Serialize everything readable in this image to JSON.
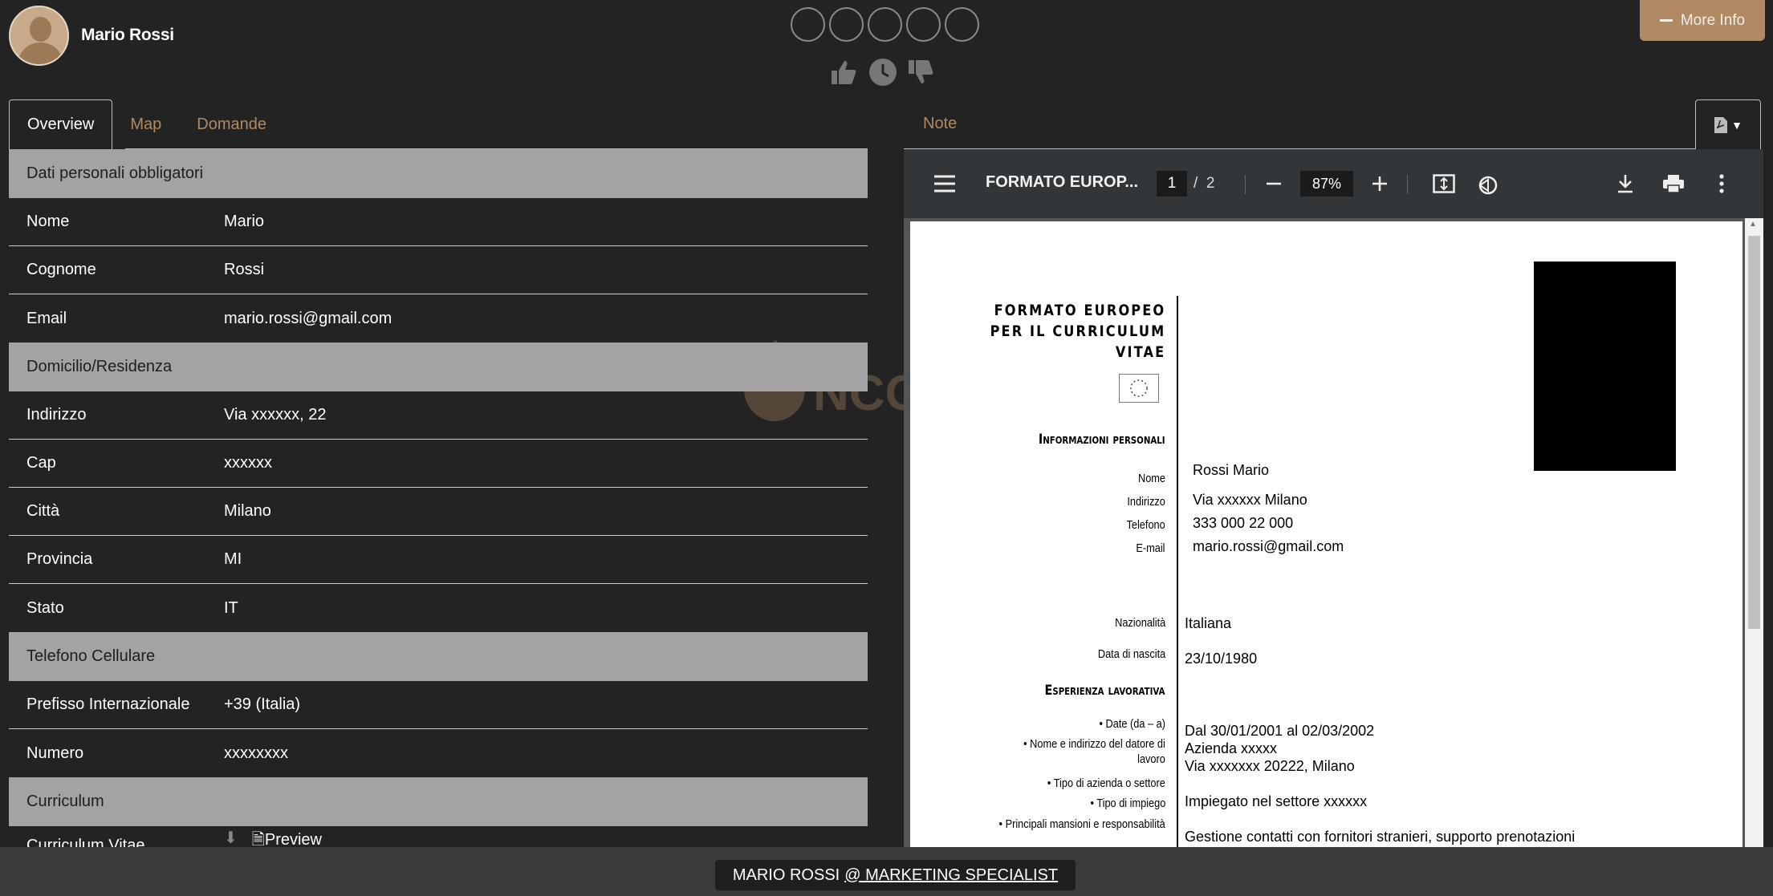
{
  "user": {
    "name": "Mario Rossi"
  },
  "header": {
    "more_info": "More Info",
    "rating_circles": 5
  },
  "tabs": [
    "Overview",
    "Map",
    "Domande"
  ],
  "right_tab": "Note",
  "sections": [
    {
      "title": "Dati personali obbligatori",
      "rows": [
        {
          "label": "Nome",
          "value": "Mario"
        },
        {
          "label": "Cognome",
          "value": "Rossi"
        },
        {
          "label": "Email",
          "value": "mario.rossi@gmail.com"
        }
      ]
    },
    {
      "title": "Domicilio/Residenza",
      "rows": [
        {
          "label": "Indirizzo",
          "value": "Via xxxxxx, 22"
        },
        {
          "label": "Cap",
          "value": "xxxxxx"
        },
        {
          "label": "Città",
          "value": "Milano"
        },
        {
          "label": "Provincia",
          "value": "MI"
        },
        {
          "label": "Stato",
          "value": "IT"
        }
      ]
    },
    {
      "title": "Telefono Cellulare",
      "rows": [
        {
          "label": "Prefisso Internazionale",
          "value": "+39 (Italia)"
        },
        {
          "label": "Numero",
          "value": "xxxxxxxx"
        }
      ]
    },
    {
      "title": "Curriculum",
      "rows": [
        {
          "label": "Curriculum Vitae",
          "value": "Preview"
        }
      ]
    }
  ],
  "viewer": {
    "title": "FORMATO EUROP...",
    "page": "1",
    "pages": "2",
    "zoom": "87%"
  },
  "cv": {
    "title": "FORMATO EUROPEO PER IL CURRICULUM VITAE",
    "title_lines": [
      "FORMATO EUROPEO",
      "PER IL CURRICULUM",
      "VITAE"
    ],
    "info_head": "Informazioni personali",
    "info": [
      {
        "label": "Nome",
        "value": "Rossi Mario"
      },
      {
        "label": "Indirizzo",
        "value": "Via xxxxxx Milano"
      },
      {
        "label": "Telefono",
        "value": "333 000 22 000"
      },
      {
        "label": "E-mail",
        "value": "mario.rossi@gmail.com"
      }
    ],
    "nazionalita_label": "Nazionalità",
    "nazionalita": "Italiana",
    "nascita_label": "Data di nascita",
    "nascita": "23/10/1980",
    "exp_head": "Esperienza lavorativa",
    "exp_labels": {
      "date": "• Date (da – a)",
      "datore1": "• Nome e indirizzo del datore di",
      "datore2": "lavoro",
      "settore": "• Tipo di azienda o settore",
      "impiego": "• Tipo di impiego",
      "mansioni": "• Principali mansioni e responsabilità"
    },
    "exp_values": {
      "date": "Dal 30/01/2001 al 02/03/2002",
      "azienda": "Azienda xxxxx",
      "indirizzo": "Via xxxxxxx 20222, Milano",
      "impiego": "Impiegato nel settore xxxxxx",
      "mansioni": "Gestione contatti con fornitori stranieri, supporto prenotazioni"
    }
  },
  "watermark": {
    "small": "HUMAN RESOU",
    "big": "NCO"
  },
  "footer": {
    "name": "MARIO ROSSI",
    "role": "@ MARKETING SPECIALIST"
  },
  "colors": {
    "accent": "#b08a63",
    "section": "#a3a3a3",
    "bg": "#232323"
  }
}
